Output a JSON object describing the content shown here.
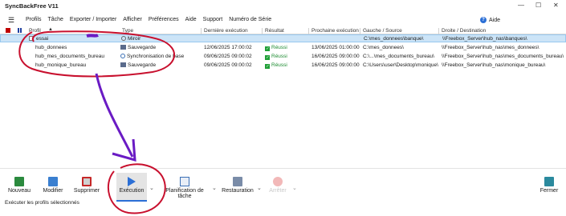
{
  "app": {
    "title": "SyncBackFree V11"
  },
  "menu": {
    "items": [
      "Profils",
      "Tâche",
      "Exporter / Importer",
      "Afficher",
      "Préférences",
      "Aide",
      "Support",
      "Numéro de Série"
    ],
    "aide_label": "Aide"
  },
  "columns": [
    "Profil",
    "Type",
    "Dernière exécution",
    "Résultat",
    "Prochaine exécution",
    "Gauche / Source",
    "Droite / Destination"
  ],
  "rows": [
    {
      "profil": "essai",
      "type": "Miroir",
      "derniere": "",
      "resultat": "",
      "prochaine": "",
      "source": "C:\\mes_donnees\\banque\\",
      "dest": "\\\\Freebox_Server\\hub_nas\\banques\\"
    },
    {
      "profil": "hub_donnees",
      "type": "Sauvegarde",
      "derniere": "12/06/2025 17:00:02",
      "resultat": "Réussi",
      "prochaine": "13/06/2025 01:00:00",
      "source": "C:\\mes_donnees\\",
      "dest": "\\\\Freebox_Server\\hub_nas\\mes_donnees\\"
    },
    {
      "profil": "hub_mes_documents_bureau",
      "type": "Synchronisation de base",
      "derniere": "09/06/2025 09:00:02",
      "resultat": "Réussi",
      "prochaine": "16/06/2025 09:00:00",
      "source": "C:\\...\\mes_documents_bureau\\",
      "dest": "\\\\Freebox_Server\\hub_nas\\mes_documents_bureau\\"
    },
    {
      "profil": "hub_monique_bureau",
      "type": "Sauvegarde",
      "derniere": "09/06/2025 09:00:02",
      "resultat": "Réussi",
      "prochaine": "16/06/2025 09:00:00",
      "source": "C:\\Users\\user\\Desktop\\monique\\",
      "dest": "\\\\Freebox_Server\\hub_nas\\monique_bureau\\"
    }
  ],
  "toolbar": {
    "nouveau": "Nouveau",
    "modifier": "Modifier",
    "supprimer": "Supprimer",
    "execution": "Exécution",
    "planification": "Planification de tâche",
    "restauration": "Restauration",
    "arreter": "Arrêter",
    "fermer": "Fermer"
  },
  "status": {
    "text": "Exécuter les profils sélectionnés"
  },
  "colors": {
    "accent": "#2b6fd6",
    "selection": "#cce4f7",
    "ok": "#21a038",
    "annotation": "#c8102e",
    "arrow": "#6a1bc4"
  }
}
